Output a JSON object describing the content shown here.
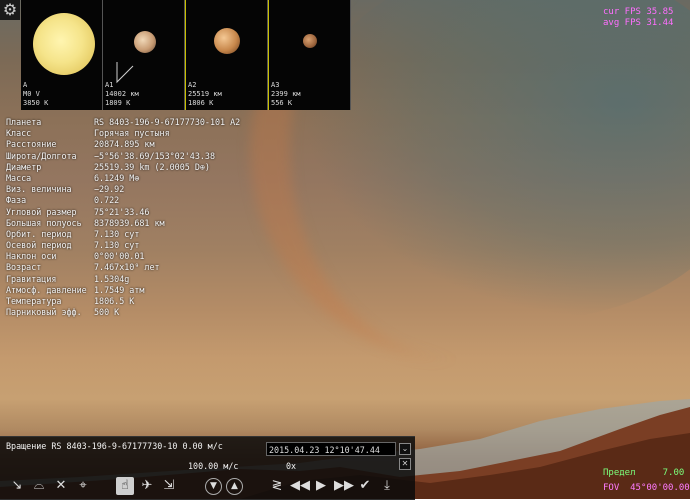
{
  "gear_icon": "gear-icon",
  "thumbnails": [
    {
      "label": "A",
      "line2": "M0 V",
      "line3": "3850 K"
    },
    {
      "label": "A1",
      "line2": "14002 км",
      "line3": "1809 K"
    },
    {
      "label": "A2",
      "line2": "25519 км",
      "line3": "1806 K"
    },
    {
      "label": "A3",
      "line2": "2399 км",
      "line3": "556 K"
    }
  ],
  "fps": {
    "cur": "cur FPS 35.85",
    "avg": "avg FPS 31.44"
  },
  "info": [
    {
      "k": "Планета",
      "v": "RS 8403-196-9-67177730-101 A2"
    },
    {
      "k": "Класс",
      "v": "Горячая пустыня"
    },
    {
      "k": "Расстояние",
      "v": "20874.895 км"
    },
    {
      "k": "Широта/Долгота",
      "v": "−5°56'38.69/153°02'43.38"
    },
    {
      "k": "Диаметр",
      "v": "25519.39 km (2.0005 D⊕)"
    },
    {
      "k": "Масса",
      "v": "6.1249 M⊕"
    },
    {
      "k": "Виз. величина",
      "v": "−29.92"
    },
    {
      "k": "Фаза",
      "v": "0.722"
    },
    {
      "k": "Угловой размер",
      "v": "75°21'33.46"
    },
    {
      "k": "Большая полуось",
      "v": "8378939.681 км"
    },
    {
      "k": "Орбит. период",
      "v": "7.130 сут"
    },
    {
      "k": "Осевой период",
      "v": "7.130 сут"
    },
    {
      "k": "Наклон оси",
      "v": "0°00'00.01"
    },
    {
      "k": "Возраст",
      "v": "7.467x10⁹ лет"
    },
    {
      "k": "Гравитация",
      "v": "1.5304g"
    },
    {
      "k": "Атмосф. давление",
      "v": "1.7549 атм"
    },
    {
      "k": "Температура",
      "v": "1806.5 K"
    },
    {
      "k": "Парниковый эфф.",
      "v": "500 K"
    }
  ],
  "bottom": {
    "rotation_text": "Вращение RS 8403-196-9-67177730-10 0.00 м/с",
    "speed": "100.00 м/с",
    "datetime": "2015.04.23 12°10'47.44",
    "time_rate": "0x"
  },
  "status": {
    "limit_label": "Предел",
    "limit_value": "7.00",
    "fov_label": "FOV",
    "fov_value": "45°00'00.00"
  },
  "icons": {
    "tool1": "select-icon",
    "tool2": "terrain-icon",
    "tool3": "move-icon",
    "tool4": "target-icon",
    "tool5": "pointer-icon",
    "tool6": "ship-icon",
    "tool7": "planet-icon",
    "nav_down": "down-icon",
    "nav_up": "up-icon",
    "t1": "fast-reverse-icon",
    "t2": "rewind-icon",
    "t3": "play-icon",
    "t4": "fast-forward-icon",
    "t5": "check-icon",
    "t6": "land-icon"
  }
}
